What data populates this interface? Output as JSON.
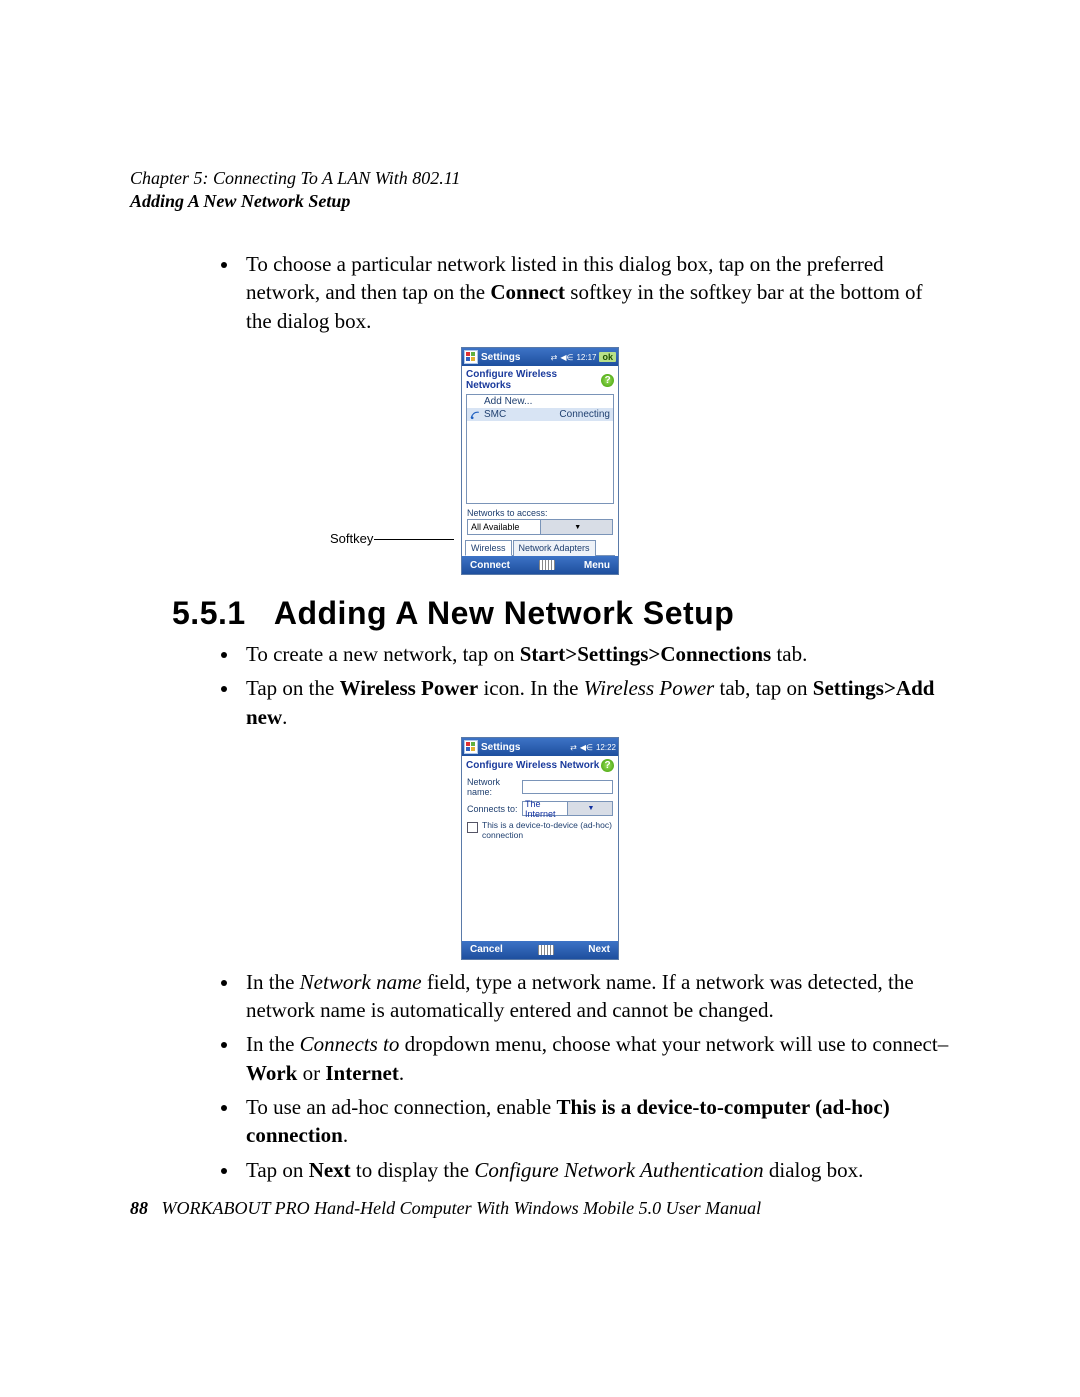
{
  "header": {
    "chapter_line": "Chapter 5: Connecting To A LAN With 802.11",
    "sub_line": "Adding A New Network Setup"
  },
  "intro_bullet": {
    "t1": "To choose a particular network listed in this dialog box, tap on the preferred network, and then tap on the ",
    "b1": "Connect",
    "t2": " softkey in the softkey bar at the bottom of the dialog box."
  },
  "softkey_label": "Softkey",
  "screen1": {
    "title": "Settings",
    "time": "12:17",
    "ok": "ok",
    "page_title": "Configure Wireless Networks",
    "add_new": "Add New...",
    "net_name": "SMC",
    "net_status": "Connecting",
    "access_label": "Networks to access:",
    "access_value": "All Available",
    "tab1": "Wireless",
    "tab2": "Network Adapters",
    "soft_left": "Connect",
    "soft_right": "Menu"
  },
  "section": {
    "number": "5.5.1",
    "title": "Adding A New Network Setup"
  },
  "list2": {
    "i1": {
      "t1": "To create a new network, tap on ",
      "b1": "Start>Settings>Connections",
      "t2": " tab."
    },
    "i2": {
      "t1": "Tap on the ",
      "b1": "Wireless Power",
      "t2": " icon. In the ",
      "i1": "Wireless Power",
      "t3": " tab, tap on ",
      "b2": "Settings>Add new",
      "t4": "."
    }
  },
  "screen2": {
    "title": "Settings",
    "time": "12:22",
    "page_title": "Configure Wireless Network",
    "name_label": "Network name:",
    "connects_label": "Connects to:",
    "connects_value": "The Internet",
    "adhoc_label": "This is a device-to-device (ad-hoc) connection",
    "soft_left": "Cancel",
    "soft_right": "Next"
  },
  "list3": {
    "i1": {
      "t1": "In the ",
      "i1": "Network name",
      "t2": " field, type a network name. If a network was detected, the network name is automatically entered and cannot be changed."
    },
    "i2": {
      "t1": "In the ",
      "i1": "Connects to",
      "t2": " dropdown menu, choose what your network will use to connect–",
      "b1": "Work",
      "t3": " or ",
      "b2": "Internet",
      "t4": "."
    },
    "i3": {
      "t1": "To use an ad-hoc connection, enable ",
      "b1": "This is a device-to-computer (ad-hoc) connection",
      "t2": "."
    },
    "i4": {
      "t1": "Tap on ",
      "b1": "Next",
      "t2": " to display the ",
      "i1": "Configure Network Authentication",
      "t3": " dialog box."
    }
  },
  "footer": {
    "page": "88",
    "text": "WORKABOUT PRO Hand-Held Computer With Windows Mobile 5.0 User Manual"
  }
}
